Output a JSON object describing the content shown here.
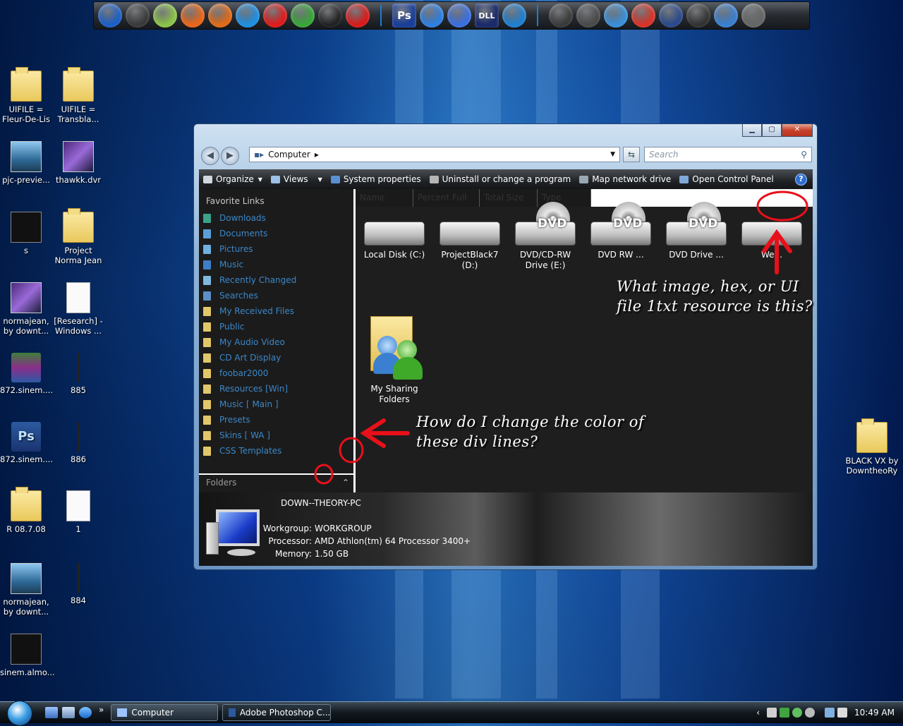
{
  "desktop": {
    "left_icons": [
      {
        "label": "UIFILE = Fleur-De-Lis",
        "kind": "folder"
      },
      {
        "label": "UIFILE = Transbla...",
        "kind": "folder"
      },
      {
        "label": "pjc-previe...",
        "kind": "thumb"
      },
      {
        "label": "thawkk.dvr",
        "kind": "thumb"
      },
      {
        "label": "s",
        "kind": "thumb"
      },
      {
        "label": "Project Norma Jean",
        "kind": "folder"
      },
      {
        "label": "normajean, by downt...",
        "kind": "thumb"
      },
      {
        "label": "[Research] - Windows ...",
        "kind": "doc"
      },
      {
        "label": "872.sinem....",
        "kind": "rar"
      },
      {
        "label": "885",
        "kind": "thin"
      },
      {
        "label": "872.sinem....",
        "kind": "psd"
      },
      {
        "label": "886",
        "kind": "thin"
      },
      {
        "label": "R 08.7.08",
        "kind": "folder"
      },
      {
        "label": "1",
        "kind": "doc"
      },
      {
        "label": "normajean, by downt...",
        "kind": "thumb"
      },
      {
        "label": "884",
        "kind": "thin"
      },
      {
        "label": "sinem.almo...",
        "kind": "thumb"
      }
    ],
    "right_icon": {
      "label": "BLACK VX by DowntheoRy",
      "kind": "folder"
    },
    "psd_badge": "Ps"
  },
  "dock": {
    "icons": [
      "media-play-icon",
      "keyboard-icon",
      "pen-icon",
      "flame-icon",
      "firefox-icon",
      "ie-icon",
      "opera-icon",
      "vuze-icon",
      "steam-icon",
      "download-icon",
      "photoshop-icon",
      "cube-icon",
      "cursor-icon",
      "dll-icon",
      "chat-icon",
      "skull-icon",
      "robot-icon",
      "feather-icon",
      "mario-icon",
      "monitor-icon",
      "guitar-icon",
      "screen-icon",
      "trash-icon"
    ],
    "ps_label": "Ps",
    "dll_label": "DLL"
  },
  "window": {
    "address": "Computer",
    "search_placeholder": "Search",
    "toolbar": [
      "Organize",
      "Views",
      "System properties",
      "Uninstall or change a program",
      "Map network drive",
      "Open Control Panel"
    ],
    "help_label": "?",
    "favorite_header": "Favorite Links",
    "favorite_links": [
      "Downloads",
      "Documents",
      "Pictures",
      "Music",
      "Recently Changed",
      "Searches",
      "My Received Files",
      "Public",
      "My Audio Video",
      "CD Art Display",
      "foobar2000",
      "Resources [Win]",
      "Music [ Main ]",
      "Presets",
      "Skins [ WA ]",
      "CSS Templates"
    ],
    "folders_label": "Folders",
    "columns": [
      "Name",
      "Percent Full",
      "Total Size",
      "Type"
    ],
    "items": [
      {
        "label": "Local Disk (C:)",
        "kind": "hdd"
      },
      {
        "label": "ProjectBlack7 (D:)",
        "kind": "hdd"
      },
      {
        "label": "DVD/CD-RW Drive (E:)",
        "kind": "dvd"
      },
      {
        "label": "DVD RW ...",
        "kind": "dvd"
      },
      {
        "label": "DVD Drive ...",
        "kind": "dvd"
      },
      {
        "label": "We...",
        "kind": "hdd"
      },
      {
        "label": "My Sharing Folders",
        "kind": "share"
      }
    ],
    "dvd_label": "DVD",
    "details": {
      "computer_name": "DOWN--THEORY-PC",
      "rows": [
        {
          "label": "Workgroup:",
          "value": "WORKGROUP"
        },
        {
          "label": "Processor:",
          "value": "AMD Athlon(tm) 64 Processor 3400+"
        },
        {
          "label": "Memory:",
          "value": "1.50 GB"
        }
      ]
    }
  },
  "annotations": {
    "top": "What image, hex, or UI file 1txt resource is this?",
    "left": "How do I change the color of these div lines?",
    "color": "#e8101a"
  },
  "taskbar": {
    "tasks": [
      "Computer",
      "Adobe Photoshop C..."
    ],
    "chevron": "»",
    "tray_chevron": "‹",
    "clock": "10:49 AM"
  }
}
